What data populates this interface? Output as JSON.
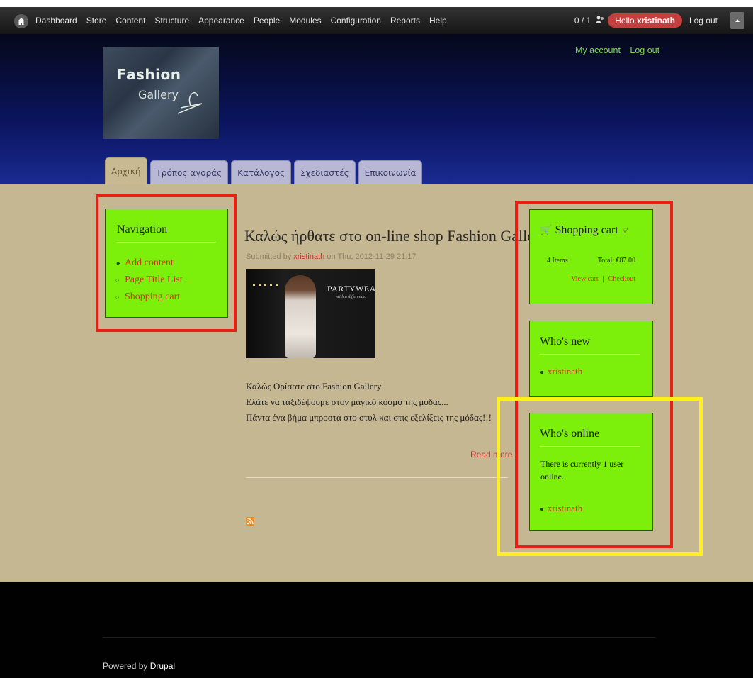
{
  "toolbar": {
    "menu": [
      "Dashboard",
      "Store",
      "Content",
      "Structure",
      "Appearance",
      "People",
      "Modules",
      "Configuration",
      "Reports",
      "Help"
    ],
    "counter": "0 / 1",
    "hello_prefix": "Hello",
    "username": "xristinath",
    "logout": "Log out"
  },
  "header": {
    "logo_line1": "Fashion",
    "logo_line2": "Gallery",
    "secondary_menu": [
      "My account",
      "Log out"
    ],
    "tabs": [
      "Αρχική",
      "Τρόπος αγοράς",
      "Κατάλογος",
      "Σχεδιαστές",
      "Επικοινωνία"
    ]
  },
  "navigation": {
    "title": "Navigation",
    "items": [
      "Add content",
      "Page Title List",
      "Shopping cart"
    ]
  },
  "node": {
    "title": "Καλώς ήρθατε στο on-line shop Fashion Gallery",
    "submitted_prefix": "Submitted by",
    "author": "xristinath",
    "submitted_suffix": "on Thu, 2012-11-29 21:17",
    "image_title": "PARTYWEAR",
    "image_subtitle": "with a difference!",
    "body": [
      "Καλώς Ορίσατε στο Fashion Gallery",
      "Ελάτε να ταξιδέψουμε στον μαγικό κόσμο της μόδας...",
      "Πάντα ένα βήμα μπροστά στο στυλ και στις εξελίξεις της μόδας!!!"
    ],
    "read_more": "Read more"
  },
  "cart": {
    "title": "Shopping cart",
    "items": "4 Items",
    "total": "Total: €87.00",
    "view_cart": "View cart",
    "sep": "|",
    "checkout": "Checkout"
  },
  "whos_new": {
    "title": "Who's new",
    "user": "xristinath"
  },
  "whos_online": {
    "title": "Who's online",
    "text": "There is currently 1 user online.",
    "user": "xristinath"
  },
  "footer": {
    "powered_prefix": "Powered by",
    "powered_link": "Drupal"
  },
  "colors": {
    "toolbar": "#1f1f1f",
    "header": "#0b1560",
    "main_bg": "#c6b793",
    "block_bg": "#7cf00a",
    "link": "#d8302b",
    "annotation_red": "#ea1f14",
    "annotation_yellow": "#ffef1a"
  }
}
